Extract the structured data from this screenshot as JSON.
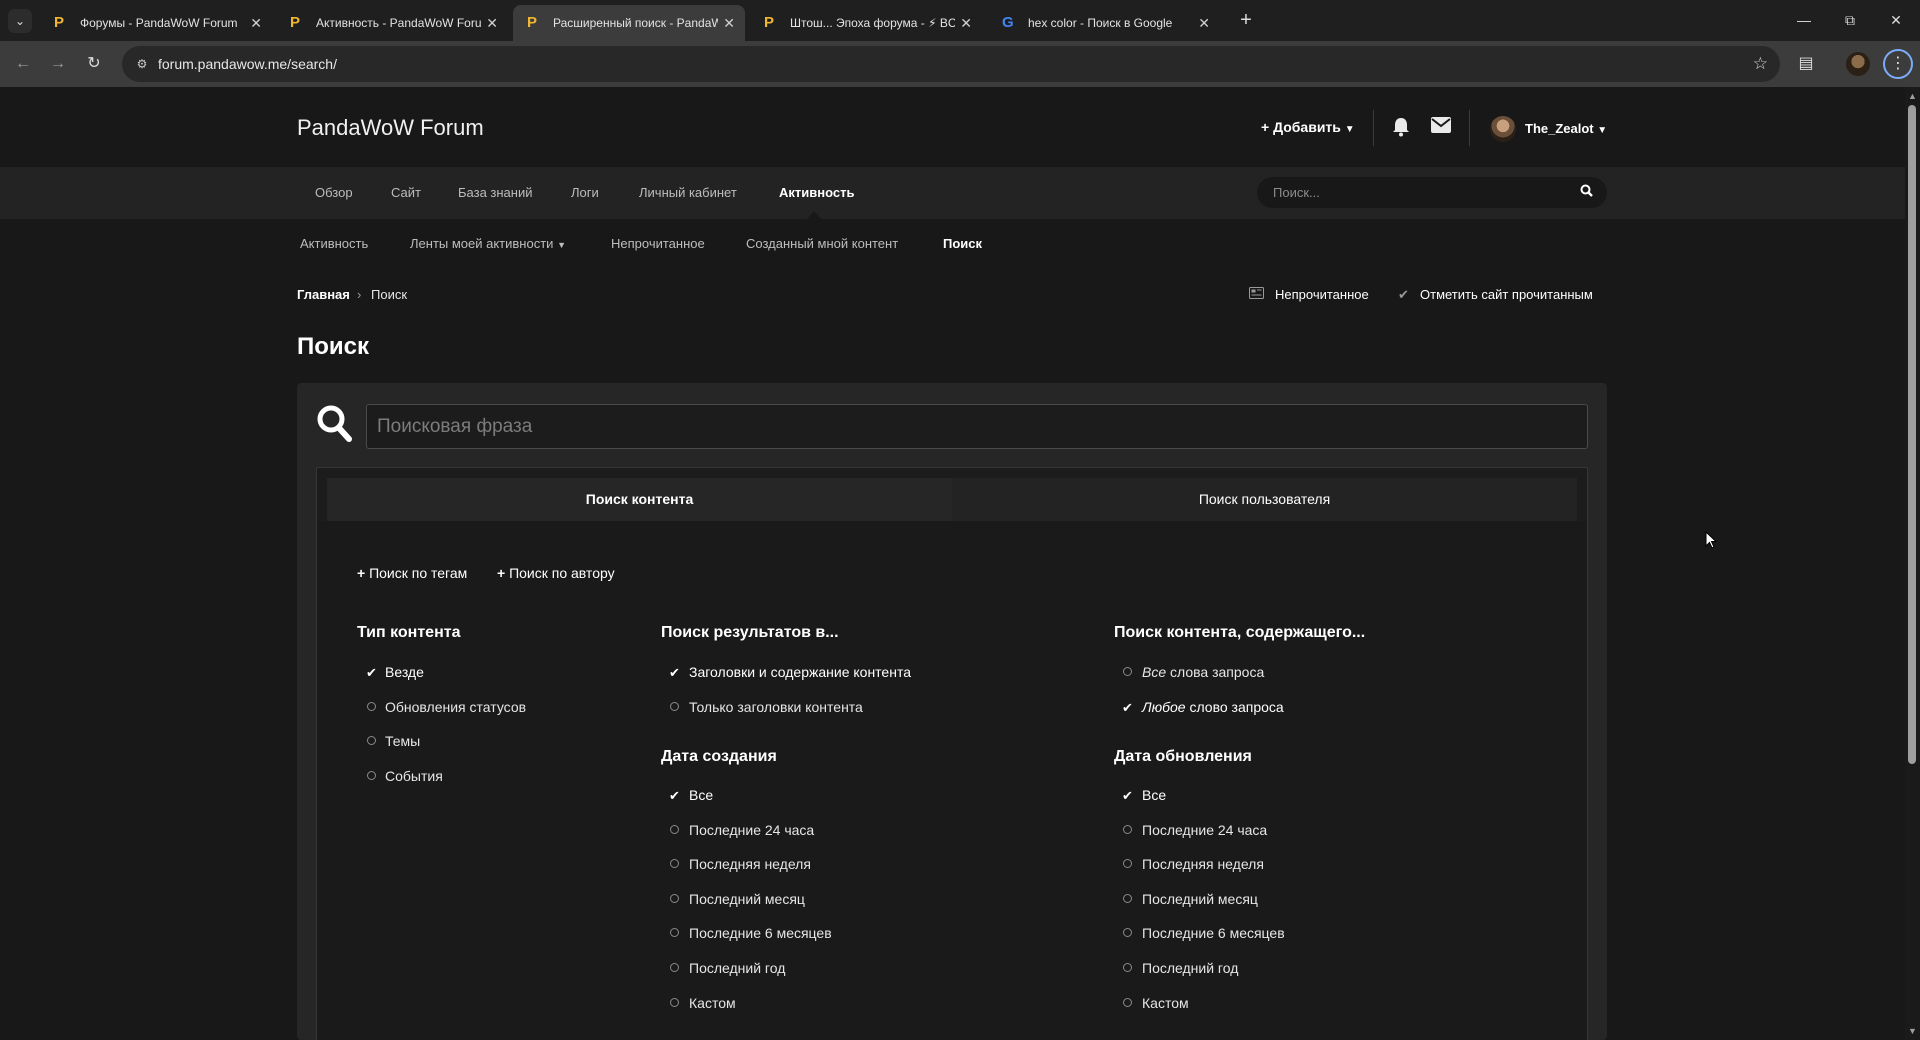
{
  "browser": {
    "tabs": [
      {
        "title": "Форумы - PandaWoW Forum",
        "favicon": "P"
      },
      {
        "title": "Активность - PandaWoW Forum",
        "favicon": "P"
      },
      {
        "title": "Расширенный поиск - PandaWoW Forum",
        "favicon": "P"
      },
      {
        "title": "Штош... Эпоха форума - ⚡ BC",
        "favicon": "P"
      },
      {
        "title": "hex color - Поиск в Google",
        "favicon": "G"
      }
    ],
    "url": "forum.pandawow.me/search/",
    "icons": {
      "back": "back-arrow-icon",
      "forward": "forward-arrow-icon",
      "reload": "reload-icon",
      "star": "star-icon",
      "extensions": "puzzle-icon",
      "menu": "kebab-menu-icon"
    }
  },
  "site": {
    "logo": "PandaWoW Forum",
    "add_label": "Добавить",
    "username": "The_Zealot",
    "nav": [
      "Обзор",
      "Сайт",
      "База знаний",
      "Логи",
      "Личный кабинет",
      "Активность"
    ],
    "search_placeholder": "Поиск...",
    "subnav": [
      "Активность",
      "Ленты моей активности",
      "Непрочитанное",
      "Созданный мной контент",
      "Поиск"
    ],
    "breadcrumb": {
      "home": "Главная",
      "current": "Поиск"
    },
    "utils": {
      "unread": "Непрочитанное",
      "mark_read": "Отметить сайт прочитанным"
    }
  },
  "search": {
    "title": "Поиск",
    "placeholder": "Поисковая фраза",
    "tabs": {
      "content": "Поиск контента",
      "user": "Поиск пользователя"
    },
    "add_tags": "Поиск по тегам",
    "add_author": "Поиск по автору",
    "content_type": {
      "title": "Тип контента",
      "options": [
        {
          "label": "Везде",
          "checked": true
        },
        {
          "label": "Обновления статусов",
          "checked": false
        },
        {
          "label": "Темы",
          "checked": false
        },
        {
          "label": "События",
          "checked": false
        }
      ]
    },
    "search_in": {
      "title": "Поиск результатов в...",
      "options": [
        {
          "label": "Заголовки и содержание контента",
          "checked": true
        },
        {
          "label": "Только заголовки контента",
          "checked": false
        }
      ]
    },
    "containing": {
      "title": "Поиск контента, содержащего...",
      "options": [
        {
          "em": "Все",
          "rest": " слова запроса",
          "checked": false
        },
        {
          "em": "Любое",
          "rest": " слово запроса",
          "checked": true
        }
      ]
    },
    "created": {
      "title": "Дата создания",
      "options": [
        {
          "label": "Все",
          "checked": true
        },
        {
          "label": "Последние 24 часа",
          "checked": false
        },
        {
          "label": "Последняя неделя",
          "checked": false
        },
        {
          "label": "Последний месяц",
          "checked": false
        },
        {
          "label": "Последние 6 месяцев",
          "checked": false
        },
        {
          "label": "Последний год",
          "checked": false
        },
        {
          "label": "Кастом",
          "checked": false
        }
      ]
    },
    "updated": {
      "title": "Дата обновления",
      "options": [
        {
          "label": "Все",
          "checked": true
        },
        {
          "label": "Последние 24 часа",
          "checked": false
        },
        {
          "label": "Последняя неделя",
          "checked": false
        },
        {
          "label": "Последний месяц",
          "checked": false
        },
        {
          "label": "Последние 6 месяцев",
          "checked": false
        },
        {
          "label": "Последний год",
          "checked": false
        },
        {
          "label": "Кастом",
          "checked": false
        }
      ]
    }
  }
}
